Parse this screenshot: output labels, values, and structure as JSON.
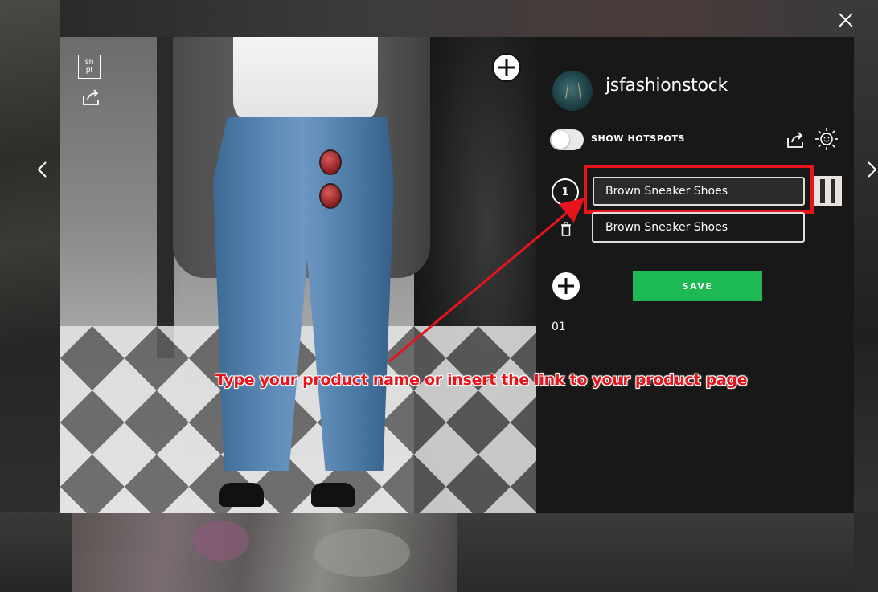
{
  "background": {
    "dim_color": "#000000"
  },
  "modal": {
    "logo": {
      "line1": "sn",
      "line2": "pt"
    },
    "account": {
      "username": "jsfashionstock"
    },
    "hotspots": {
      "label": "SHOW HOTSPOTS",
      "enabled": false
    },
    "product": {
      "number": "1",
      "input_value": "Brown Sneaker Shoes",
      "suggestion": "Brown Sneaker Shoes"
    },
    "save_label": "SAVE",
    "count": "01"
  },
  "annotation": {
    "text": "Type your product name or insert the link to your product page",
    "color": "#e8141c"
  },
  "colors": {
    "accent_green": "#1db954",
    "highlight_red": "#e8141c",
    "panel_bg": "#181818"
  },
  "icons": {
    "close": "close-icon",
    "prev": "chevron-left-icon",
    "next": "chevron-right-icon",
    "share": "share-icon",
    "sun": "sun-icon",
    "add": "plus-circle-icon",
    "trash": "trash-icon"
  }
}
